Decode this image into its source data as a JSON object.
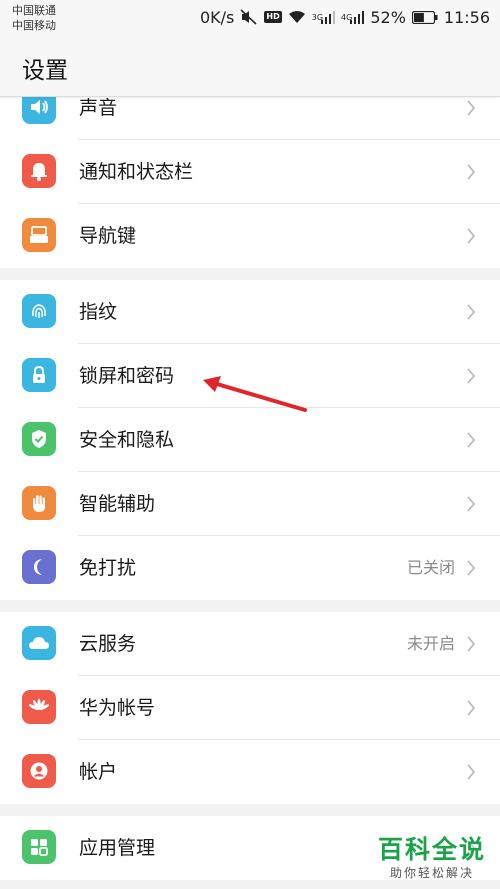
{
  "status_bar": {
    "carrier_1": "中国联通",
    "carrier_2": "中国移动",
    "net_speed": "0K/s",
    "hd_badge": "HD",
    "net_3g": "3G",
    "net_4g": "4G",
    "battery": "52%",
    "time": "11:56",
    "battery_level": 0.52
  },
  "header": {
    "title": "设置"
  },
  "groups": [
    {
      "rows": [
        {
          "label": "声音",
          "icon": "speaker-icon",
          "color": "#3bb6e0"
        },
        {
          "label": "通知和状态栏",
          "icon": "bell-icon",
          "color": "#ef5a4a"
        },
        {
          "label": "导航键",
          "icon": "navigation-key-icon",
          "color": "#f08a3c"
        }
      ]
    },
    {
      "rows": [
        {
          "label": "指纹",
          "icon": "fingerprint-icon",
          "color": "#3bb6e0"
        },
        {
          "label": "锁屏和密码",
          "icon": "lock-icon",
          "color": "#3bb6e0"
        },
        {
          "label": "安全和隐私",
          "icon": "shield-check-icon",
          "color": "#4cc36a"
        },
        {
          "label": "智能辅助",
          "icon": "hand-icon",
          "color": "#f08a3c"
        },
        {
          "label": "免打扰",
          "icon": "moon-icon",
          "color": "#6a6fd0",
          "value": "已关闭"
        }
      ]
    },
    {
      "rows": [
        {
          "label": "云服务",
          "icon": "cloud-icon",
          "color": "#3bb6e0",
          "value": "未开启"
        },
        {
          "label": "华为帐号",
          "icon": "huawei-logo-icon",
          "color": "#ef5a4a"
        },
        {
          "label": "帐户",
          "icon": "person-icon",
          "color": "#ef5a4a"
        }
      ]
    },
    {
      "rows": [
        {
          "label": "应用管理",
          "icon": "apps-grid-icon",
          "color": "#4cc36a"
        }
      ]
    }
  ],
  "colors": {
    "annotation_arrow": "#e0262a",
    "watermark_green": "#1aa34a"
  },
  "watermark": {
    "main": "百科全说",
    "sub": "助你轻松解决"
  }
}
